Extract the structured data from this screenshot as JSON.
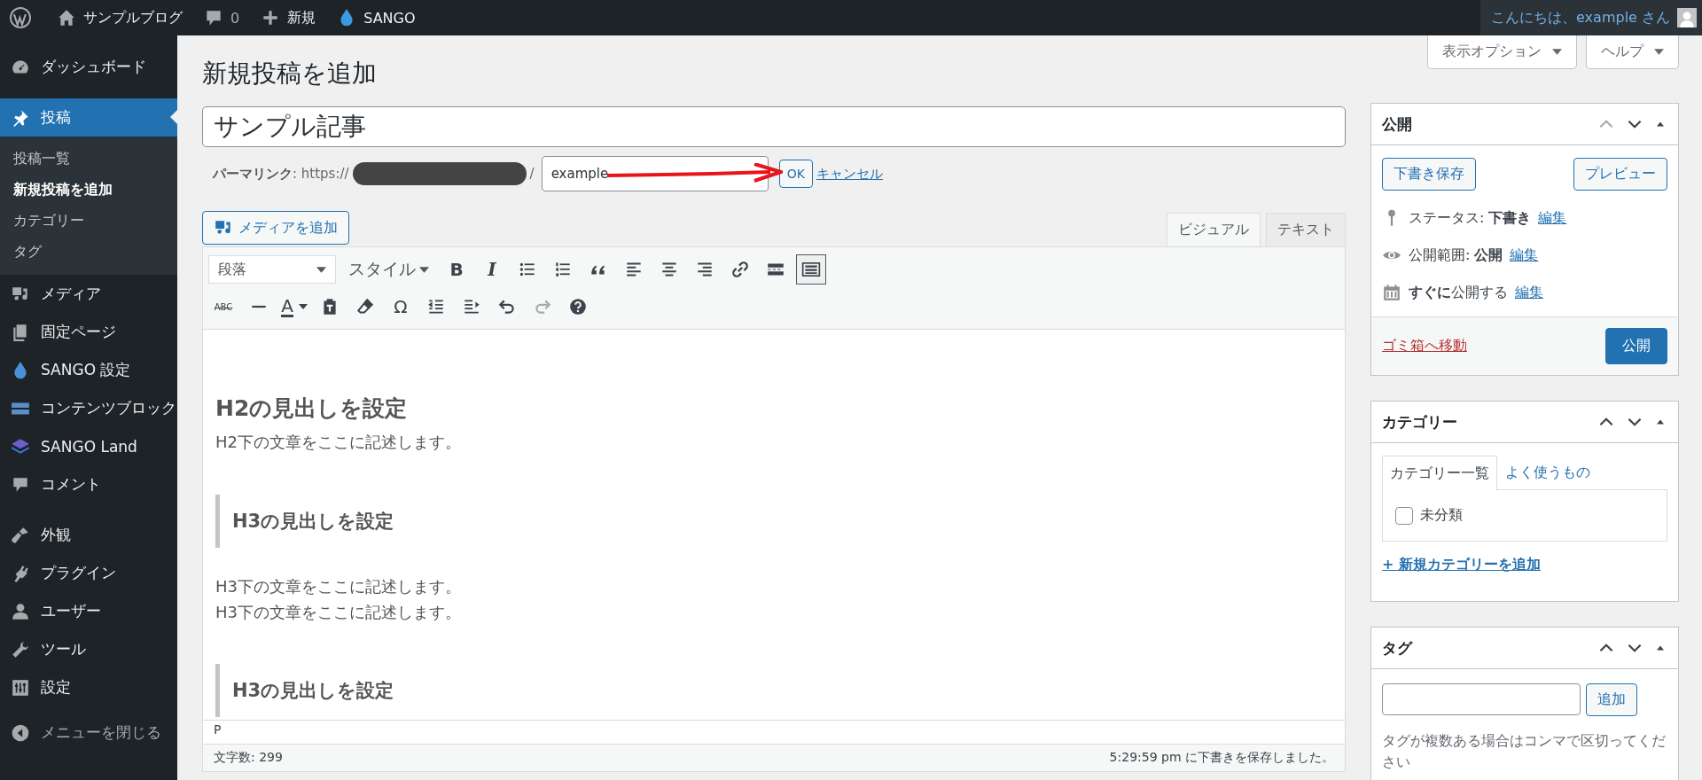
{
  "admin_bar": {
    "site_name": "サンプルブログ",
    "comments": "0",
    "new": "新規",
    "theme": "SANGO",
    "greeting": "こんにちは、example さん"
  },
  "sidebar": {
    "groups": [
      [
        {
          "label": "ダッシュボード",
          "kind": "dashboard",
          "selected": false
        }
      ],
      [
        {
          "label": "投稿",
          "kind": "pin",
          "selected": true,
          "children": [
            {
              "label": "投稿一覧",
              "selected": false
            },
            {
              "label": "新規投稿を追加",
              "selected": true
            },
            {
              "label": "カテゴリー",
              "selected": false
            },
            {
              "label": "タグ",
              "selected": false
            }
          ]
        },
        {
          "label": "メディア",
          "kind": "media",
          "selected": false
        },
        {
          "label": "固定ページ",
          "kind": "pages",
          "selected": false
        },
        {
          "label": "SANGO 設定",
          "kind": "drop",
          "selected": false
        },
        {
          "label": "コンテンツブロック",
          "kind": "blocks",
          "selected": false
        },
        {
          "label": "SANGO Land",
          "kind": "layers",
          "selected": false
        },
        {
          "label": "コメント",
          "kind": "comment",
          "selected": false
        }
      ],
      [
        {
          "label": "外観",
          "kind": "brush",
          "selected": false
        },
        {
          "label": "プラグイン",
          "kind": "plugin",
          "selected": false
        },
        {
          "label": "ユーザー",
          "kind": "user",
          "selected": false
        },
        {
          "label": "ツール",
          "kind": "wrench",
          "selected": false
        },
        {
          "label": "設定",
          "kind": "settings",
          "selected": false
        }
      ]
    ],
    "collapse": "メニューを閉じる"
  },
  "screen_meta": [
    "表示オプション",
    "ヘルプ"
  ],
  "page_title": "新規投稿を追加",
  "post_title": "サンプル記事",
  "permalink": {
    "label": "パーマリンク",
    "prefix": ": https://",
    "suffix": "/",
    "slug": "example",
    "ok": "OK",
    "cancel": "キャンセル"
  },
  "media_button": "メディアを追加",
  "editor_tabs": [
    {
      "label": "ビジュアル",
      "selected": true
    },
    {
      "label": "テキスト",
      "selected": false
    }
  ],
  "toolbar": {
    "format": "段落",
    "style": "スタイル",
    "rows": [
      [
        {
          "kind": "bold",
          "label": "B",
          "pressed": false,
          "disabled": false
        },
        {
          "kind": "italic",
          "label": "I",
          "pressed": false,
          "disabled": false
        },
        {
          "kind": "bullet-list",
          "pressed": false,
          "disabled": false
        },
        {
          "kind": "numbered-list",
          "pressed": false,
          "disabled": false
        },
        {
          "kind": "quote",
          "pressed": false,
          "disabled": false
        },
        {
          "kind": "align-left",
          "pressed": false,
          "disabled": false
        },
        {
          "kind": "align-center",
          "pressed": false,
          "disabled": false
        },
        {
          "kind": "align-right",
          "pressed": false,
          "disabled": false
        },
        {
          "kind": "link",
          "pressed": false,
          "disabled": false
        },
        {
          "kind": "read-more",
          "pressed": false,
          "disabled": false
        },
        {
          "kind": "toolbar-toggle",
          "pressed": true,
          "disabled": false
        }
      ],
      [
        {
          "kind": "strikethrough",
          "label": "ABC",
          "pressed": false,
          "disabled": false
        },
        {
          "kind": "horizontal-line",
          "pressed": false,
          "disabled": false
        },
        {
          "kind": "text-color",
          "label": "A",
          "pressed": false,
          "disabled": false
        },
        {
          "kind": "paste-text",
          "pressed": false,
          "disabled": false
        },
        {
          "kind": "clear-format",
          "pressed": false,
          "disabled": false
        },
        {
          "kind": "special-char",
          "label": "Ω",
          "pressed": false,
          "disabled": false
        },
        {
          "kind": "outdent",
          "pressed": false,
          "disabled": false
        },
        {
          "kind": "indent",
          "pressed": false,
          "disabled": false
        },
        {
          "kind": "undo",
          "pressed": false,
          "disabled": false
        },
        {
          "kind": "redo",
          "pressed": false,
          "disabled": true
        },
        {
          "kind": "help",
          "pressed": false,
          "disabled": false
        }
      ]
    ]
  },
  "content": [
    {
      "kind": "h2",
      "text": "H2の見出しを設定"
    },
    {
      "kind": "p",
      "lines": [
        "H2下の文章をここに記述します。"
      ]
    },
    {
      "kind": "h3",
      "text": "H3の見出しを設定"
    },
    {
      "kind": "p",
      "lines": [
        "H3下の文章をここに記述します。",
        "H3下の文章をここに記述します。"
      ]
    },
    {
      "kind": "h3",
      "text": "H3の見出しを設定"
    }
  ],
  "status_path": "P",
  "word_count": "文字数: 299",
  "autosave": "5:29:59 pm に下書きを保存しました。",
  "publish_box": {
    "title": "公開",
    "move_up_disabled": true,
    "save_draft": "下書き保存",
    "preview": "プレビュー",
    "rows": [
      {
        "kind": "status",
        "text": "ステータス: **下書き**",
        "link": "編集"
      },
      {
        "kind": "visibility",
        "text": "公開範囲: **公開**",
        "link": "編集"
      },
      {
        "kind": "schedule",
        "text": "**すぐに**公開する",
        "link": "編集"
      }
    ],
    "trash": "ゴミ箱へ移動",
    "publish": "公開"
  },
  "category_box": {
    "title": "カテゴリー",
    "move_up_disabled": false,
    "tabs": [
      {
        "label": "カテゴリー一覧",
        "selected": true
      },
      {
        "label": "よく使うもの",
        "selected": false
      }
    ],
    "items": [
      {
        "label": "未分類",
        "checked": false
      }
    ],
    "add_link": "+ 新規カテゴリーを追加"
  },
  "tag_box": {
    "title": "タグ",
    "move_up_disabled": false,
    "add": "追加",
    "hint": "タグが複数ある場合はコンマで区切ってください"
  }
}
